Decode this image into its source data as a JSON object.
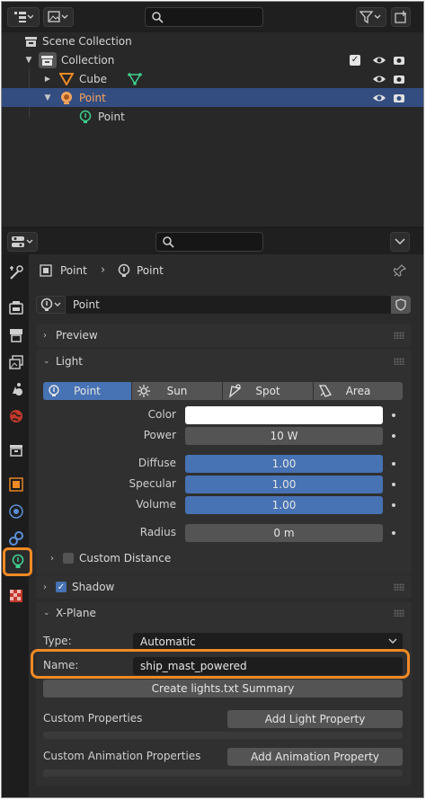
{
  "outliner": {
    "rows": [
      {
        "label": "Scene Collection"
      },
      {
        "label": "Collection"
      },
      {
        "label": "Cube"
      },
      {
        "label": "Point"
      },
      {
        "label": "Point"
      }
    ]
  },
  "properties": {
    "breadcrumb": {
      "object": "Point",
      "data": "Point"
    },
    "datablock": "Point",
    "panels": {
      "preview": "Preview",
      "light": "Light",
      "shadow": "Shadow",
      "xplane": "X-Plane"
    },
    "light_types": [
      "Point",
      "Sun",
      "Spot",
      "Area"
    ],
    "light": {
      "color_label": "Color",
      "power_label": "Power",
      "power_value": "10 W",
      "diffuse_label": "Diffuse",
      "diffuse_value": "1.00",
      "specular_label": "Specular",
      "specular_value": "1.00",
      "volume_label": "Volume",
      "volume_value": "1.00",
      "radius_label": "Radius",
      "radius_value": "0 m",
      "custom_distance_label": "Custom Distance"
    },
    "xplane": {
      "type_label": "Type:",
      "type_value": "Automatic",
      "name_label": "Name:",
      "name_value": "ship_mast_powered",
      "summary_button": "Create lights.txt Summary",
      "custom_props_label": "Custom Properties",
      "add_light_prop_button": "Add Light Property",
      "custom_anim_label": "Custom Animation Properties",
      "add_anim_prop_button": "Add Animation Property"
    }
  },
  "colors": {
    "accent_orange": "#f08a24",
    "selection_blue": "#334d80",
    "slider_blue": "#4772b3"
  }
}
